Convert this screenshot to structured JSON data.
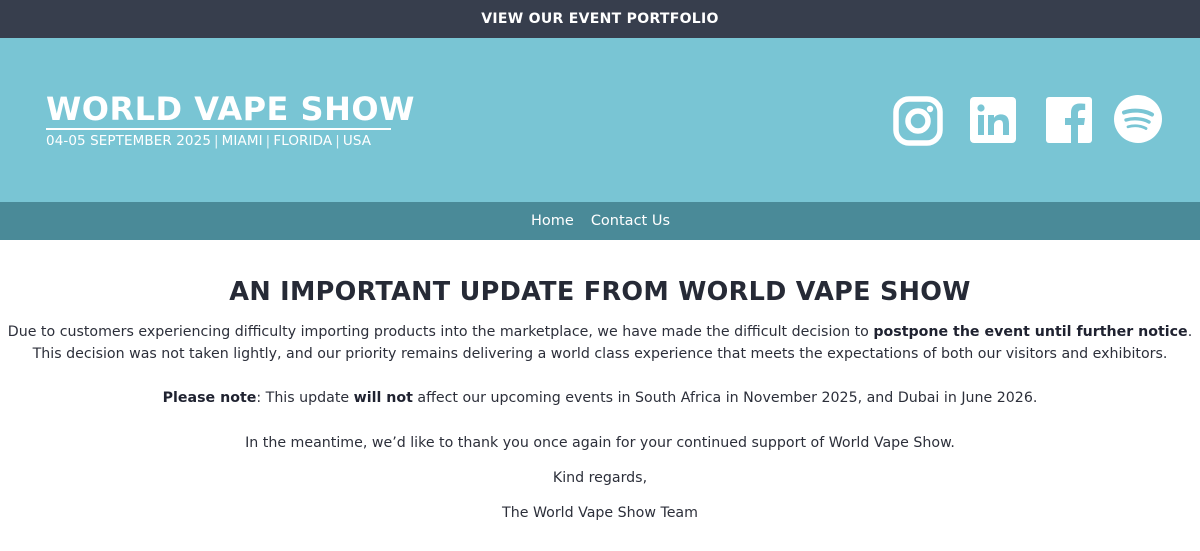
{
  "topbar": {
    "label": "VIEW OUR EVENT PORTFOLIO"
  },
  "logo": {
    "title": "WORLD VAPE SHOW",
    "dates": "04-05 SEPTEMBER 2025",
    "city": "MIAMI",
    "state": "FLORIDA",
    "country": "USA",
    "separator": "|"
  },
  "social": [
    {
      "icon": "instagram-icon"
    },
    {
      "icon": "linkedin-icon"
    },
    {
      "icon": "facebook-icon"
    },
    {
      "icon": "spotify-icon"
    }
  ],
  "nav": {
    "home": "Home",
    "contact": "Contact Us"
  },
  "content": {
    "heading": "AN IMPORTANT UPDATE FROM WORLD VAPE SHOW",
    "p1_pre": "Due to customers experiencing difficulty importing products into the marketplace, we have made the difficult decision to ",
    "p1_bold": "postpone the event until further notice",
    "p1_post": ".",
    "p1_line2": "This decision was not taken lightly, and our priority remains delivering a world class experience that meets the expectations of both our visitors and exhibitors.",
    "p2_bold1": "Please note",
    "p2_mid": ": This update ",
    "p2_bold2": "will not",
    "p2_post": " affect our upcoming events in South Africa in November 2025, and Dubai in June 2026.",
    "p3": "In the meantime, we’d like to thank you once again for your continued support of World Vape Show.",
    "p4": "Kind regards,",
    "p5": "The World Vape Show Team"
  },
  "colors": {
    "topbar_bg": "#373e4d",
    "hero_bg": "#79c5d4",
    "nav_bg": "#4a8a98",
    "text": "#2c2f3a",
    "white": "#ffffff"
  }
}
